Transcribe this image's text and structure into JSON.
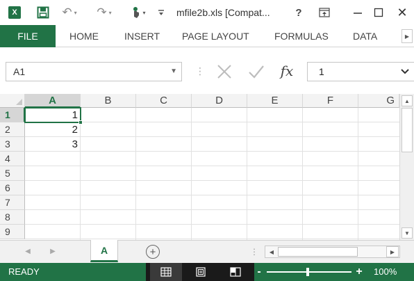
{
  "window": {
    "title": "mfile2b.xls  [Compat...",
    "app_logo_letter": "X",
    "help_label": "?",
    "icons": [
      "excel-logo-icon",
      "save-icon",
      "undo-icon",
      "redo-icon",
      "touch-mode-icon",
      "customize-qat-icon",
      "help-icon",
      "ribbon-display-icon",
      "minimize-icon",
      "maximize-icon",
      "close-icon"
    ]
  },
  "ribbon": {
    "tabs": [
      {
        "label": "FILE"
      },
      {
        "label": "HOME"
      },
      {
        "label": "INSERT"
      },
      {
        "label": "PAGE LAYOUT"
      },
      {
        "label": "FORMULAS"
      },
      {
        "label": "DATA"
      }
    ]
  },
  "formula_bar": {
    "name_box": "A1",
    "formula_value": "1",
    "fx_label": "fx"
  },
  "grid": {
    "columns": [
      "A",
      "B",
      "C",
      "D",
      "E",
      "F",
      "G"
    ],
    "rows": [
      "1",
      "2",
      "3",
      "4",
      "5",
      "6",
      "7",
      "8",
      "9"
    ],
    "selected_column": "A",
    "selected_row": "1",
    "cells": [
      {
        "ref": "A1",
        "value": "1"
      },
      {
        "ref": "A2",
        "value": "2"
      },
      {
        "ref": "A3",
        "value": "3"
      }
    ]
  },
  "sheets": {
    "tabs": [
      {
        "label": "A",
        "active": true
      }
    ],
    "new_sheet_label": "+"
  },
  "status": {
    "text": "READY",
    "zoom": "100%",
    "zoom_minus": "-",
    "zoom_plus": "+"
  },
  "colors": {
    "accent": "#217346",
    "status_bar": "#217346"
  }
}
